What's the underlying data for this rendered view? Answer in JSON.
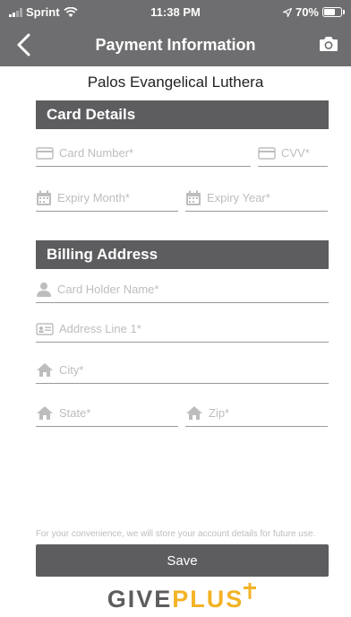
{
  "status": {
    "carrier": "Sprint",
    "time": "11:38 PM",
    "battery": "70%",
    "battery_level": 0.7
  },
  "nav": {
    "title": "Payment Information",
    "back_icon": "chevron-left-icon",
    "camera_icon": "camera-icon"
  },
  "church_name": "Palos Evangelical Luthera",
  "card_section": {
    "title": "Card Details",
    "card_number_placeholder": "Card Number*",
    "cvv_placeholder": "CVV*",
    "expiry_month_placeholder": "Expiry Month*",
    "expiry_year_placeholder": "Expiry Year*"
  },
  "billing_section": {
    "title": "Billing Address",
    "holder_placeholder": "Card Holder Name*",
    "address_placeholder": "Address Line 1*",
    "city_placeholder": "City*",
    "state_placeholder": "State*",
    "zip_placeholder": "Zip*"
  },
  "footer": {
    "note": "For your convenience, we will store your account details for future use.",
    "save_label": "Save"
  },
  "logo": {
    "give": "GIVE",
    "plus": "PLUS"
  },
  "colors": {
    "bar": "#6e6e70",
    "section": "#5d5d60",
    "accent": "#f3b326"
  }
}
